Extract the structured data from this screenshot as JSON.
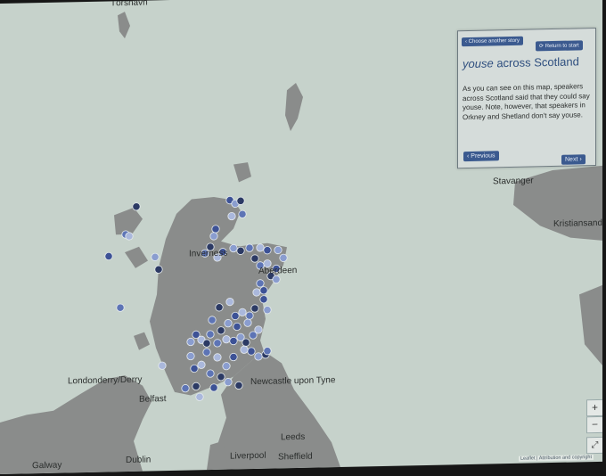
{
  "map": {
    "cities": [
      {
        "id": "torshavn",
        "label": "Tórshavn"
      },
      {
        "id": "inverness",
        "label": "Inverness"
      },
      {
        "id": "aberdeen",
        "label": "Aberdeen"
      },
      {
        "id": "stavanger",
        "label": "Stavanger"
      },
      {
        "id": "kristiansand",
        "label": "Kristiansand"
      },
      {
        "id": "londonderry",
        "label": "Londonderry/Derry"
      },
      {
        "id": "belfast",
        "label": "Belfast"
      },
      {
        "id": "newcastle",
        "label": "Newcastle upon Tyne"
      },
      {
        "id": "leeds",
        "label": "Leeds"
      },
      {
        "id": "dublin",
        "label": "Dublin"
      },
      {
        "id": "liverpool",
        "label": "Liverpool"
      },
      {
        "id": "sheffield",
        "label": "Sheffield"
      },
      {
        "id": "galway",
        "label": "Galway"
      }
    ],
    "marker_colors": [
      "#2c3a64",
      "#3d5296",
      "#5d74b5",
      "#8a9dcf",
      "#aab8dc"
    ],
    "land_color": "#8a8c8b",
    "sea_color": "#c6d2cb"
  },
  "panel": {
    "choose_label": "‹ Choose another story",
    "return_label": "⟳ Return to start",
    "title_word": "youse",
    "title_rest": "across Scotland",
    "body": "As you can see on this map, speakers across Scotland said that they could say youse. Note, however, that speakers in Orkney and Shetland don't say youse.",
    "prev_label": "‹ Previous",
    "next_label": "Next ›"
  },
  "controls": {
    "zoom_in": "+",
    "zoom_out": "−",
    "fullscreen": "⤢",
    "attribution": "Leaflet | Attribution and copyright"
  }
}
